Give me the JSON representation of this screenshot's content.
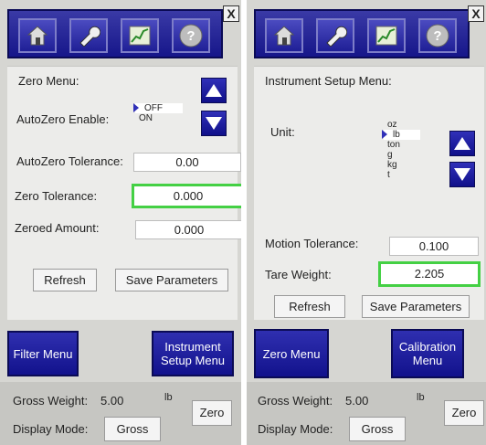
{
  "close_label": "X",
  "icons": [
    "home-icon",
    "wrench-icon",
    "graph-icon",
    "help-icon"
  ],
  "left": {
    "menu_title": "Zero Menu:",
    "autozero_label": "AutoZero Enable:",
    "autozero_options": [
      "OFF",
      "ON"
    ],
    "autozero_selected": "OFF",
    "autozero_tolerance_label": "AutoZero Tolerance:",
    "autozero_tolerance_value": "0.00",
    "zero_tolerance_label": "Zero Tolerance:",
    "zero_tolerance_value": "0.000",
    "zeroed_amount_label": "Zeroed Amount:",
    "zeroed_amount_value": "0.000",
    "refresh_label": "Refresh",
    "save_label": "Save Parameters",
    "nav_left": "Filter Menu",
    "nav_right": "Instrument Setup Menu",
    "gross_label": "Gross Weight:",
    "gross_value": "5.00",
    "gross_unit": "lb",
    "zero_button": "Zero",
    "display_mode_label": "Display Mode:",
    "display_mode_value": "Gross"
  },
  "right": {
    "menu_title": "Instrument Setup Menu:",
    "unit_label": "Unit:",
    "unit_options": [
      "oz",
      "lb",
      "ton",
      "g",
      "kg",
      "t"
    ],
    "unit_selected": "lb",
    "motion_tolerance_label": "Motion Tolerance:",
    "motion_tolerance_value": "0.100",
    "tare_weight_label": "Tare Weight:",
    "tare_weight_value": "2.205",
    "refresh_label": "Refresh",
    "save_label": "Save Parameters",
    "nav_left": "Zero Menu",
    "nav_right": "Calibration Menu",
    "gross_label": "Gross Weight:",
    "gross_value": "5.00",
    "gross_unit": "lb",
    "zero_button": "Zero",
    "display_mode_label": "Display Mode:",
    "display_mode_value": "Gross"
  },
  "colors": {
    "toolbar": "#1f1f96",
    "highlight": "#44d044",
    "panel": "#d6d6d2"
  }
}
